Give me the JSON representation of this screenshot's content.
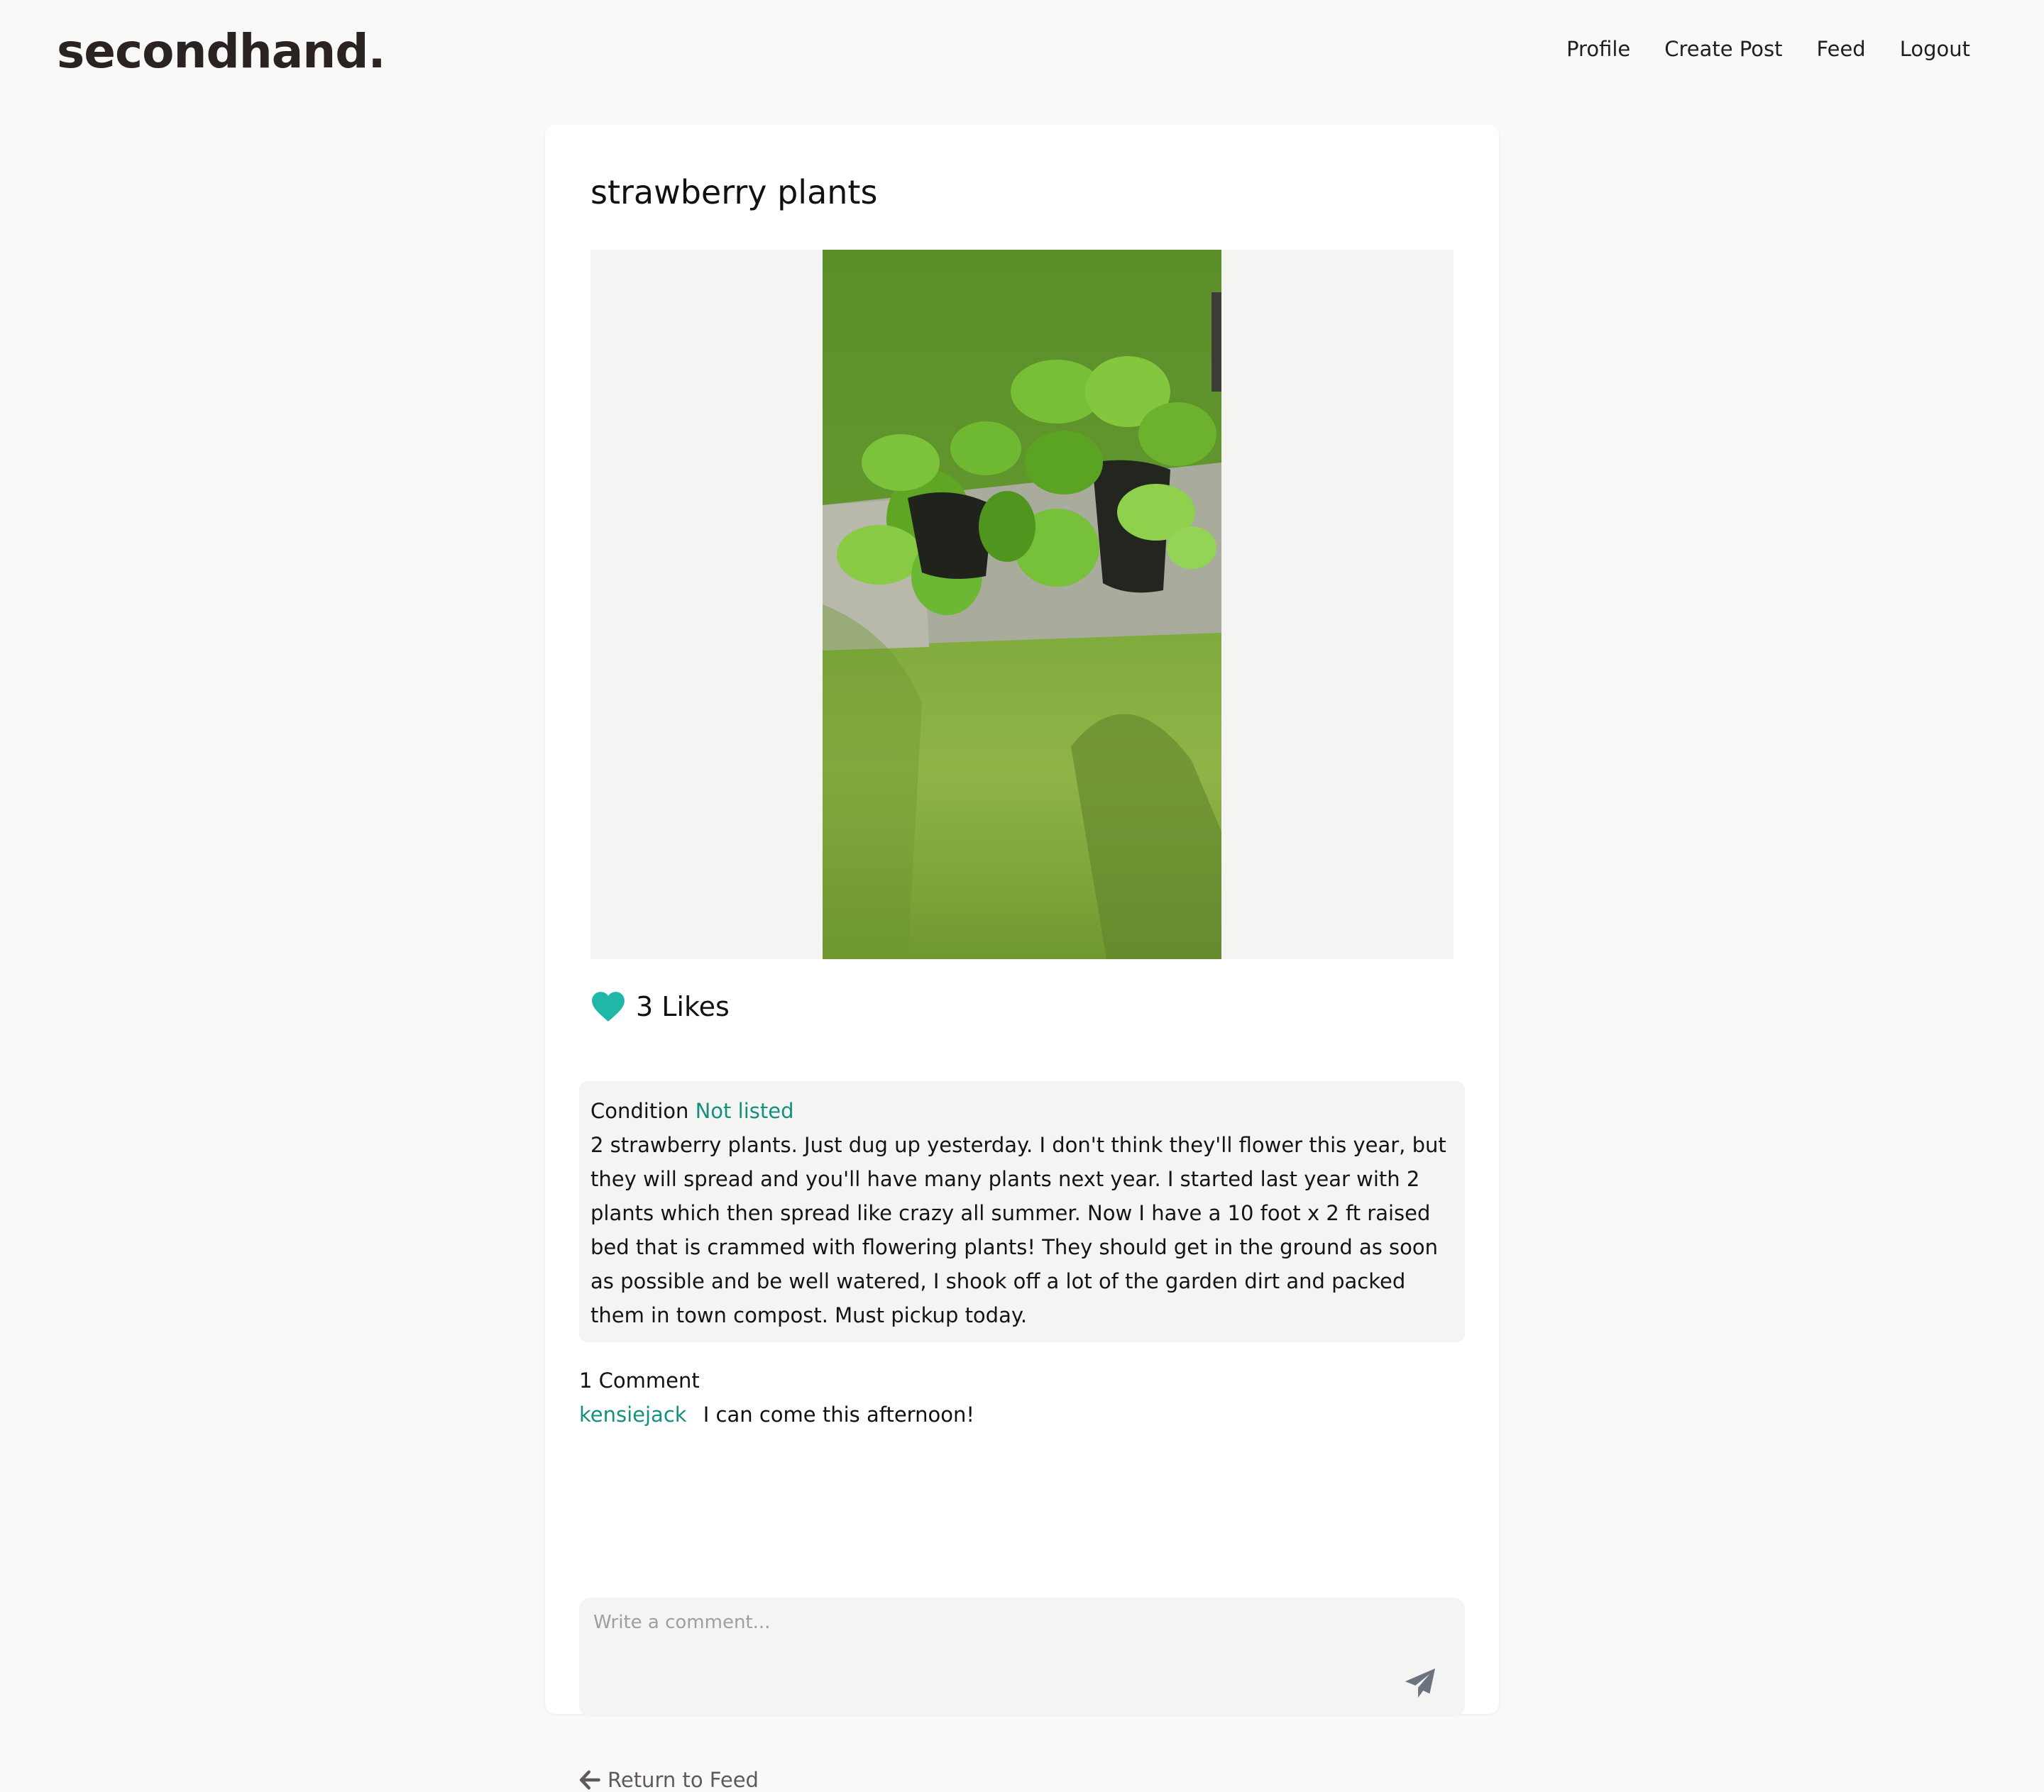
{
  "brand": {
    "logo": "secondhand."
  },
  "nav": {
    "items": [
      "Profile",
      "Create Post",
      "Feed",
      "Logout"
    ]
  },
  "post": {
    "title": "strawberry plants",
    "likes_label": "3 Likes",
    "condition_label": "Condition",
    "condition_value": "Not listed",
    "description": "2 strawberry plants. Just dug up yesterday. I don't think they'll flower this year, but they will spread and you'll have many plants next year. I started last year with 2 plants which then spread like crazy all summer. Now I have a 10 foot x 2 ft raised bed that is crammed with flowering plants! They should get in the ground as soon as possible and be well watered, I shook off a lot of the garden dirt and packed them in town compost. Must pickup today."
  },
  "comments": {
    "count_label": "1 Comment",
    "items": [
      {
        "user": "kensiejack",
        "text": "I can come this afternoon!"
      }
    ]
  },
  "comment_form": {
    "placeholder": "Write a comment..."
  },
  "footer": {
    "back_label": "Return to Feed"
  },
  "colors": {
    "accent": "#15907f",
    "heart": "#1fb8a7",
    "panel": "#f4f4f3",
    "background": "#f9f9f8"
  },
  "icons": {
    "like": "heart-icon",
    "send": "paper-plane-icon",
    "back": "arrow-left-icon"
  }
}
